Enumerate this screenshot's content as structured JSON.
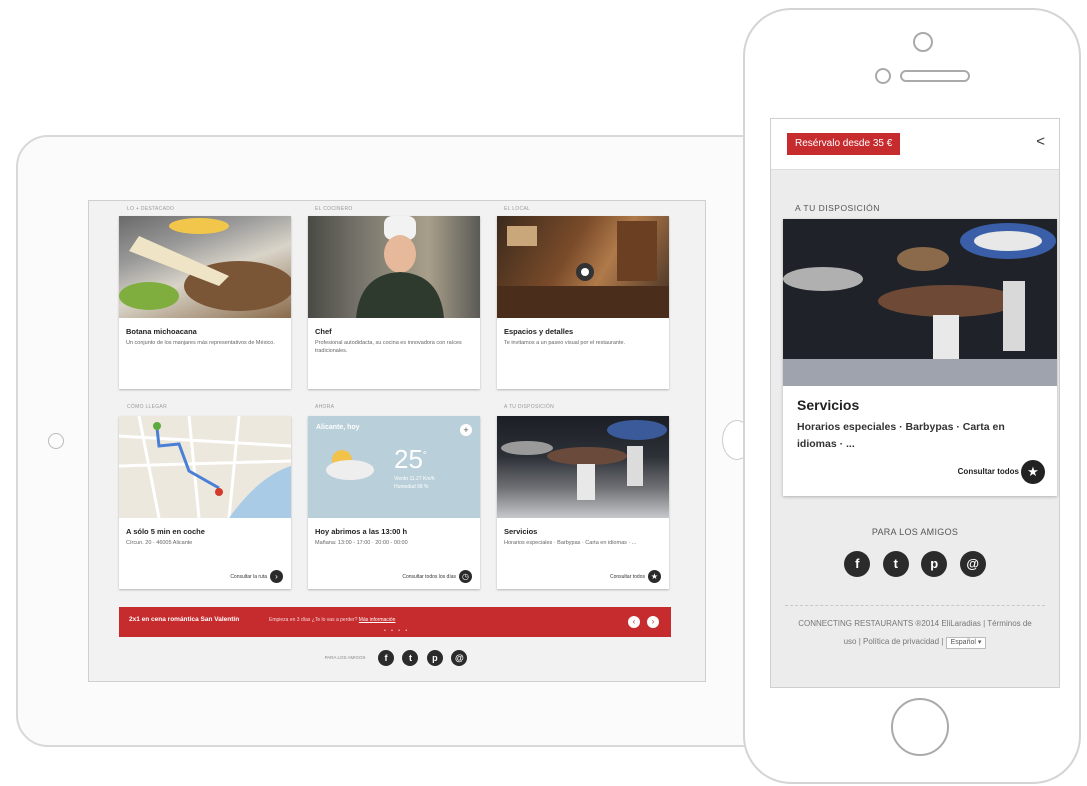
{
  "tablet": {
    "sections": {
      "destacado": "LO + DESTACADO",
      "cocinero": "EL COCINERO",
      "local": "EL LOCAL",
      "llegar": "CÓMO LLEGAR",
      "ahora": "AHORA",
      "disposicion": "A TU DISPOSICIÓN"
    },
    "cards": [
      {
        "title": "Botana michoacana",
        "desc": "Un conjunto de los manjares más representativos de México.",
        "image": "food-photo"
      },
      {
        "title": "Chef",
        "desc": "Profesional autodidacta, su cocina es innovadora con raíces tradicionales.",
        "image": "chef-photo"
      },
      {
        "title": "Espacios y detalles",
        "desc": "Te invitamos a un paseo visual por el restaurante.",
        "image": "restaurant-interior-photo"
      },
      {
        "title": "A sólo 5 min en coche",
        "desc": "Círcun. 20 · 46005 Alicante",
        "link": "Consultar la ruta",
        "image": "map"
      },
      {
        "title": "Hoy abrimos a las 13:00 h",
        "desc": "Mañana: 13:00 - 17:00 · 20:00 - 00:00",
        "link": "Consultar todos los días",
        "image": "weather"
      },
      {
        "title": "Servicios",
        "desc": "Horarios especiales · Barbypas · Carta en idiomas · ...",
        "link": "Consultar todos",
        "image": "bowls-photo"
      }
    ],
    "weather": {
      "city": "Alicante, hoy",
      "temp": "25",
      "unit": "°",
      "wind": "Viento 11.27 Km/h",
      "humidity": "Humedad 68 %"
    },
    "promo": {
      "title": "2x1 en cena romántica San Valentín",
      "text": "Empieza en 3 días ¿Te lo vas a perder?",
      "link": "Más información",
      "dots": "• • • •"
    },
    "social_label": "PARA LOS AMIGOS",
    "social": [
      "f",
      "t",
      "p",
      "@"
    ]
  },
  "phone": {
    "reserve_label": "Resérvalo desde 35 €",
    "section": "A TU DISPOSICIÓN",
    "card": {
      "title": "Servicios",
      "desc": "Horarios especiales · Barbypas · Carta en idiomas · ...",
      "link": "Consultar todos"
    },
    "friends": "PARA LOS AMIGOS",
    "social": [
      "f",
      "t",
      "p",
      "@"
    ],
    "footer": {
      "line1": "CONNECTING RESTAURANTS ®2014 EliLaradias | Términos de",
      "line2": "uso | Política de privacidad |",
      "lang": "Español"
    }
  }
}
